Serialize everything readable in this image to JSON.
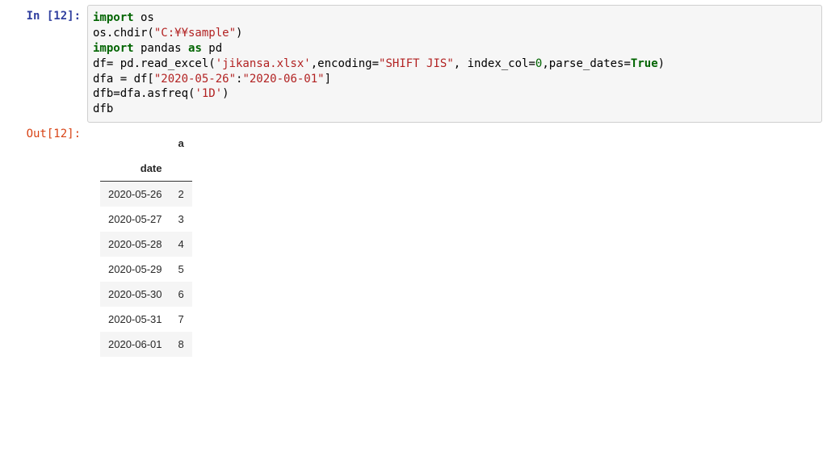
{
  "input": {
    "prompt": "In [12]:",
    "code": {
      "l1": {
        "kw": "import",
        "mod": " os"
      },
      "l2": {
        "pre": "os.chdir(",
        "str": "\"C:¥¥sample\"",
        "post": ")"
      },
      "l3": {
        "kw": "import",
        "mod": " pandas ",
        "kw2": "as",
        "alias": " pd"
      },
      "l4": {
        "pre": "df= pd.read_excel(",
        "str1": "'jikansa.xlsx'",
        "mid1": ",encoding=",
        "str2": "\"SHIFT JIS\"",
        "mid2": ", index_col=",
        "num": "0",
        "mid3": ",parse_dates=",
        "bool": "True",
        "post": ")"
      },
      "l5": {
        "pre": "dfa = df[",
        "str1": "\"2020-05-26\"",
        "mid": ":",
        "str2": "\"2020-06-01\"",
        "post": "]"
      },
      "l6": {
        "pre": "dfb=dfa.asfreq(",
        "str": "'1D'",
        "post": ")"
      },
      "l7": {
        "txt": "dfb"
      }
    }
  },
  "output": {
    "prompt": "Out[12]:",
    "index_name": "date",
    "columns": [
      "a"
    ],
    "rows": [
      {
        "idx": "2020-05-26",
        "vals": [
          "2"
        ]
      },
      {
        "idx": "2020-05-27",
        "vals": [
          "3"
        ]
      },
      {
        "idx": "2020-05-28",
        "vals": [
          "4"
        ]
      },
      {
        "idx": "2020-05-29",
        "vals": [
          "5"
        ]
      },
      {
        "idx": "2020-05-30",
        "vals": [
          "6"
        ]
      },
      {
        "idx": "2020-05-31",
        "vals": [
          "7"
        ]
      },
      {
        "idx": "2020-06-01",
        "vals": [
          "8"
        ]
      }
    ]
  },
  "chart_data": {
    "type": "table",
    "index_name": "date",
    "columns": [
      "a"
    ],
    "records": [
      {
        "date": "2020-05-26",
        "a": 2
      },
      {
        "date": "2020-05-27",
        "a": 3
      },
      {
        "date": "2020-05-28",
        "a": 4
      },
      {
        "date": "2020-05-29",
        "a": 5
      },
      {
        "date": "2020-05-30",
        "a": 6
      },
      {
        "date": "2020-05-31",
        "a": 7
      },
      {
        "date": "2020-06-01",
        "a": 8
      }
    ]
  }
}
